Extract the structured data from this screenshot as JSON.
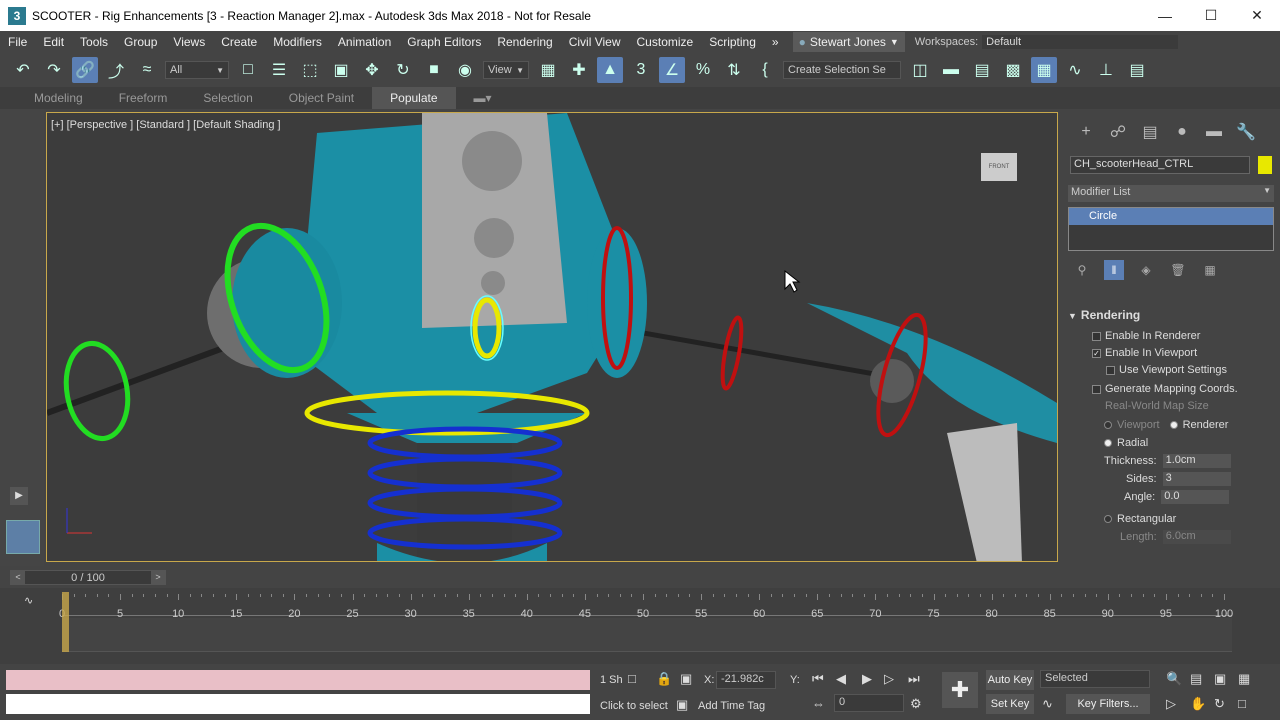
{
  "window": {
    "app_icon": "3",
    "title": "SCOOTER - Rig Enhancements [3 - Reaction Manager 2].max - Autodesk 3ds Max 2018 - Not for Resale",
    "min": "—",
    "max": "☐",
    "close": "✕"
  },
  "menu": {
    "items": [
      "File",
      "Edit",
      "Tools",
      "Group",
      "Views",
      "Create",
      "Modifiers",
      "Animation",
      "Graph Editors",
      "Rendering",
      "Civil View",
      "Customize",
      "Scripting"
    ],
    "overflow": "»",
    "user": "Stewart Jones",
    "workspaces_label": "Workspaces:",
    "workspace_value": "Default"
  },
  "toolbar": {
    "selection_filter": "All",
    "ref_coord": "View",
    "selection_set": "Create Selection Se"
  },
  "ribbon": {
    "tabs": [
      "Modeling",
      "Freeform",
      "Selection",
      "Object Paint",
      "Populate"
    ],
    "active": "Populate"
  },
  "viewport": {
    "label": "[+] [Perspective ] [Standard ] [Default Shading ]",
    "viewcube_text": "FRONT"
  },
  "command_panel": {
    "object_name": "CH_scooterHead_CTRL",
    "object_color": "#e8e800",
    "modifier_list": "Modifier List",
    "stack_item": "Circle",
    "rendering": {
      "header": "Rendering",
      "enable_in_renderer": "Enable In Renderer",
      "enable_in_viewport": "Enable In Viewport",
      "use_viewport_settings": "Use Viewport Settings",
      "generate_mapping": "Generate Mapping Coords.",
      "real_world": "Real-World Map Size",
      "viewport": "Viewport",
      "renderer": "Renderer",
      "radial": "Radial",
      "thickness_label": "Thickness:",
      "thickness": "1.0cm",
      "sides_label": "Sides:",
      "sides": "3",
      "angle_label": "Angle:",
      "angle": "0.0",
      "rectangular": "Rectangular",
      "length_label": "Length:",
      "length": "6.0cm"
    }
  },
  "timeline": {
    "frame_display": "0 / 100",
    "prev": "<",
    "next": ">",
    "ticks": [
      0,
      5,
      10,
      15,
      20,
      25,
      30,
      35,
      40,
      45,
      50,
      55,
      60,
      65,
      70,
      75,
      80,
      85,
      90,
      95,
      100
    ]
  },
  "status": {
    "selected_count": "1 Sh",
    "x_label": "X:",
    "x_value": "-21.982c",
    "y_label": "Y:",
    "prompt": "Click to select",
    "add_time_tag": "Add Time Tag",
    "current_frame": "0",
    "auto_key": "Auto Key",
    "set_key": "Set Key",
    "key_mode": "Selected",
    "key_filters": "Key Filters..."
  }
}
